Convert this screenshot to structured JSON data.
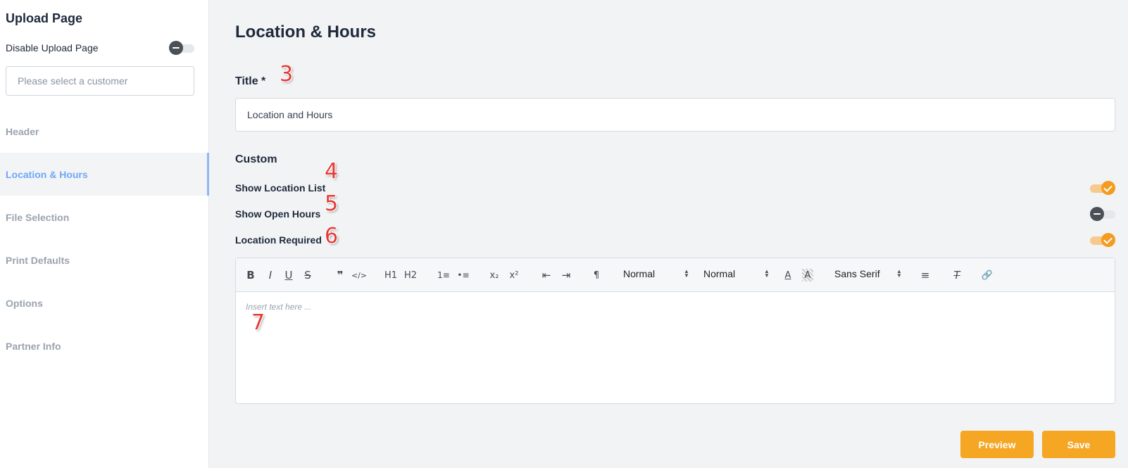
{
  "sidebar": {
    "title": "Upload Page",
    "disable_label": "Disable Upload Page",
    "disable_toggle_on": false,
    "customer_placeholder": "Please select a customer",
    "items": [
      {
        "label": "Header"
      },
      {
        "label": "Location & Hours",
        "active": true
      },
      {
        "label": "File Selection"
      },
      {
        "label": "Print Defaults"
      },
      {
        "label": "Options"
      },
      {
        "label": "Partner Info"
      }
    ]
  },
  "main": {
    "title": "Location & Hours",
    "title_field": {
      "label": "Title *",
      "value": "Location and Hours"
    },
    "custom_label": "Custom",
    "options": [
      {
        "label": "Show Location List",
        "on": true
      },
      {
        "label": "Show Open Hours",
        "on": false
      },
      {
        "label": "Location Required",
        "on": true
      }
    ],
    "editor": {
      "placeholder": "Insert text here ...",
      "toolbar": {
        "bold": "B",
        "italic": "I",
        "underline": "U",
        "strike": "S",
        "quote": "❞",
        "code": "</>",
        "h1": "H1",
        "h2": "H2",
        "ordered_list": "1≡",
        "bullet_list": "•≡",
        "subscript": "x₂",
        "superscript": "x²",
        "outdent": "⇤",
        "indent": "⇥",
        "direction": "¶",
        "size_select": "Normal",
        "header_select": "Normal",
        "font_color": "A",
        "background_color": "A",
        "font_select": "Sans Serif",
        "align": "≡",
        "clean": "T",
        "link": "🔗"
      }
    },
    "annotations": [
      "3",
      "4",
      "5",
      "6",
      "7"
    ],
    "buttons": {
      "preview": "Preview",
      "save": "Save"
    }
  },
  "colors": {
    "accent": "#f5a623",
    "active_nav": "#6ea8f5",
    "toggle_on": "#f39c1f"
  }
}
